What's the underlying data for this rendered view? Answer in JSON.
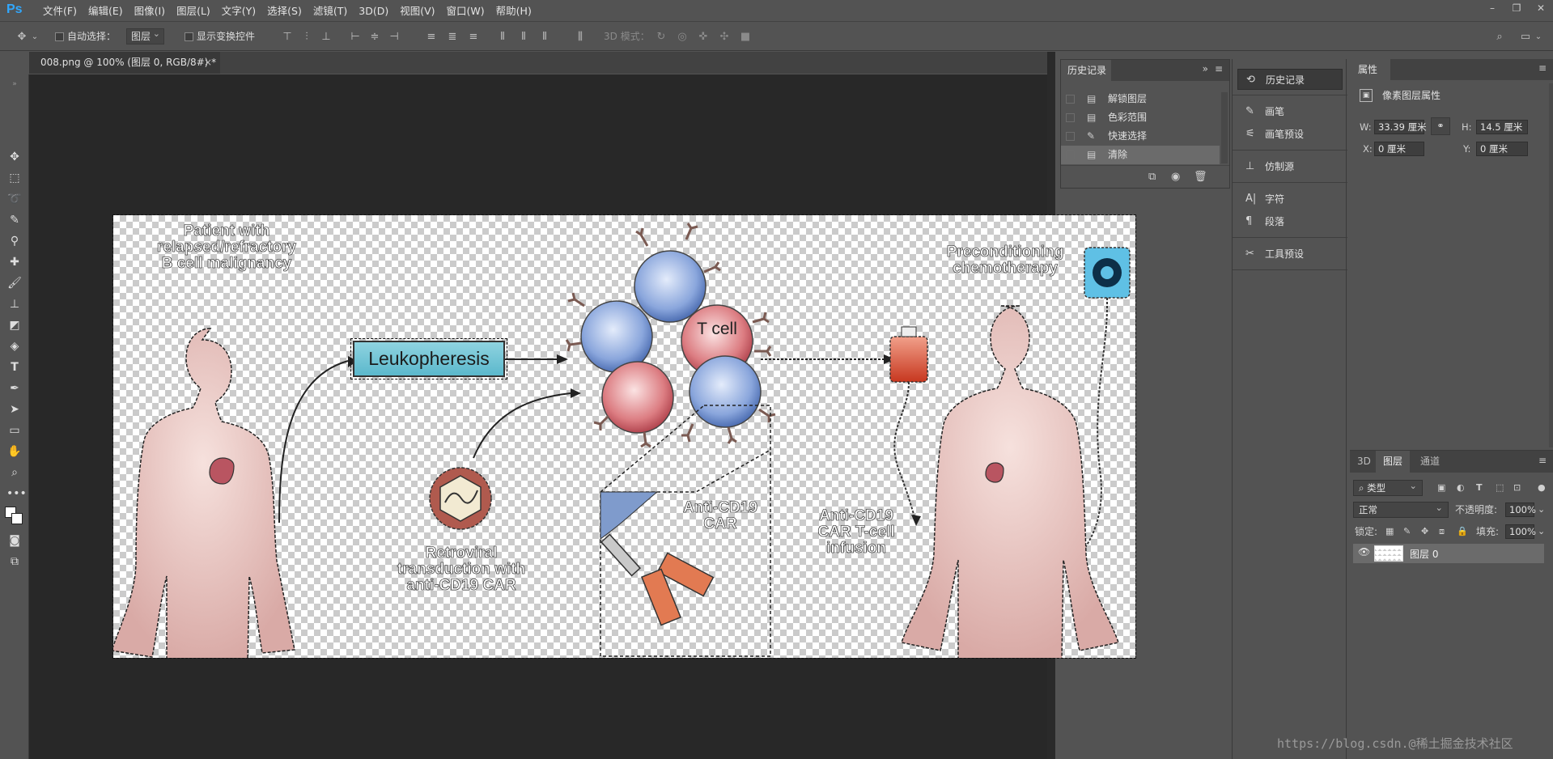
{
  "app": {
    "logo": "Ps",
    "menu": [
      "文件(F)",
      "编辑(E)",
      "图像(I)",
      "图层(L)",
      "文字(Y)",
      "选择(S)",
      "滤镜(T)",
      "3D(D)",
      "视图(V)",
      "窗口(W)",
      "帮助(H)"
    ],
    "window_controls": [
      "–",
      "❐",
      "✕"
    ]
  },
  "options": {
    "auto_select_label": "自动选择：",
    "auto_select_value": "图层",
    "show_transform_label": "显示变换控件",
    "mode_3d_label": "3D 模式："
  },
  "document": {
    "tab_title": "008.png @ 100% (图层 0, RGB/8#) *",
    "tab_close": "×"
  },
  "artwork": {
    "patient_label": "Patient with\nrelapsed/refractory\nB cell malignancy",
    "leukopheresis": "Leukopheresis",
    "t_cell_label": "T\ncell",
    "retroviral_label": "Retroviral\ntransduction with\nanti-CD19 CAR",
    "anti_cd19_car_label": "Anti-CD19\nCAR",
    "infusion_label": "Anti-CD19\nCAR T-cell\ninfusion",
    "preconditioning_label": "Preconditioning\nchemotherapy"
  },
  "history": {
    "tab": "历史记录",
    "steps": [
      {
        "label": "解锁图层",
        "icon": "document-icon",
        "active": false
      },
      {
        "label": "色彩范围",
        "icon": "document-icon",
        "active": false
      },
      {
        "label": "快速选择",
        "icon": "brush-icon",
        "active": false
      },
      {
        "label": "清除",
        "icon": "document-icon",
        "active": true
      }
    ]
  },
  "dock": {
    "items": [
      {
        "label": "历史记录",
        "icon": "history-icon"
      },
      {
        "label": "画笔",
        "icon": "brush-icon"
      },
      {
        "label": "画笔预设",
        "icon": "brush-preset-icon"
      },
      {
        "label": "仿制源",
        "icon": "clone-source-icon"
      },
      {
        "label": "字符",
        "icon": "character-icon"
      },
      {
        "label": "段落",
        "icon": "paragraph-icon"
      },
      {
        "label": "工具预设",
        "icon": "tool-preset-icon"
      }
    ]
  },
  "properties": {
    "tab": "属性",
    "title": "像素图层属性",
    "w_label": "W:",
    "w_value": "33.39 厘米",
    "h_label": "H:",
    "h_value": "14.5 厘米",
    "x_label": "X:",
    "x_value": "0 厘米",
    "y_label": "Y:",
    "y_value": "0 厘米"
  },
  "layers": {
    "tabs": [
      "3D",
      "图层",
      "通道"
    ],
    "active_tab": "图层",
    "filter_kind": "类型",
    "blend_mode": "正常",
    "opacity_label": "不透明度:",
    "opacity_value": "100%",
    "lock_label": "锁定:",
    "fill_label": "填充:",
    "fill_value": "100%",
    "layer_name": "图层 0"
  },
  "watermark": "https://blog.csdn.@稀土掘金技术社区"
}
